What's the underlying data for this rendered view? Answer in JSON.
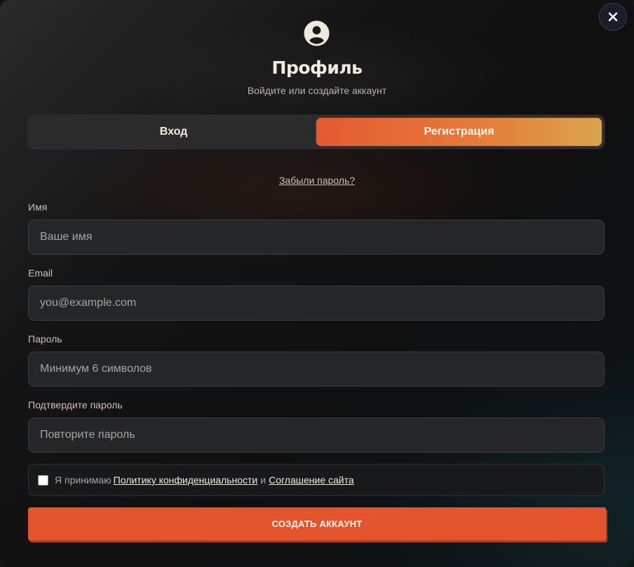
{
  "header": {
    "title": "Профиль",
    "subtitle": "Войдите или создайте аккаунт",
    "avatar_icon": "user-circle-icon",
    "close_icon": "close-icon"
  },
  "tabs": [
    {
      "label": "Вход",
      "active": false
    },
    {
      "label": "Регистрация",
      "active": true
    }
  ],
  "forgot_password_link": "Забыли пароль?",
  "form": {
    "name": {
      "label": "Имя",
      "placeholder": "Ваше имя",
      "value": ""
    },
    "email": {
      "label": "Email",
      "placeholder": "you@example.com",
      "value": ""
    },
    "password": {
      "label": "Пароль",
      "placeholder": "Минимум 6 символов",
      "value": ""
    },
    "confirm_password": {
      "label": "Подтвердите пароль",
      "placeholder": "Повторите пароль",
      "value": ""
    }
  },
  "consent": {
    "checked": false,
    "prefix": "Я принимаю",
    "privacy_link": "Политику конфиденциальности",
    "conjunction": "и",
    "terms_link": "Соглашение сайта"
  },
  "submit_label": "СОЗДАТЬ АККАУНТ",
  "colors": {
    "accent": "#e5552d",
    "tab_gradient_start": "#e55a30",
    "tab_gradient_end": "#d9a44a",
    "background": "#141414"
  }
}
